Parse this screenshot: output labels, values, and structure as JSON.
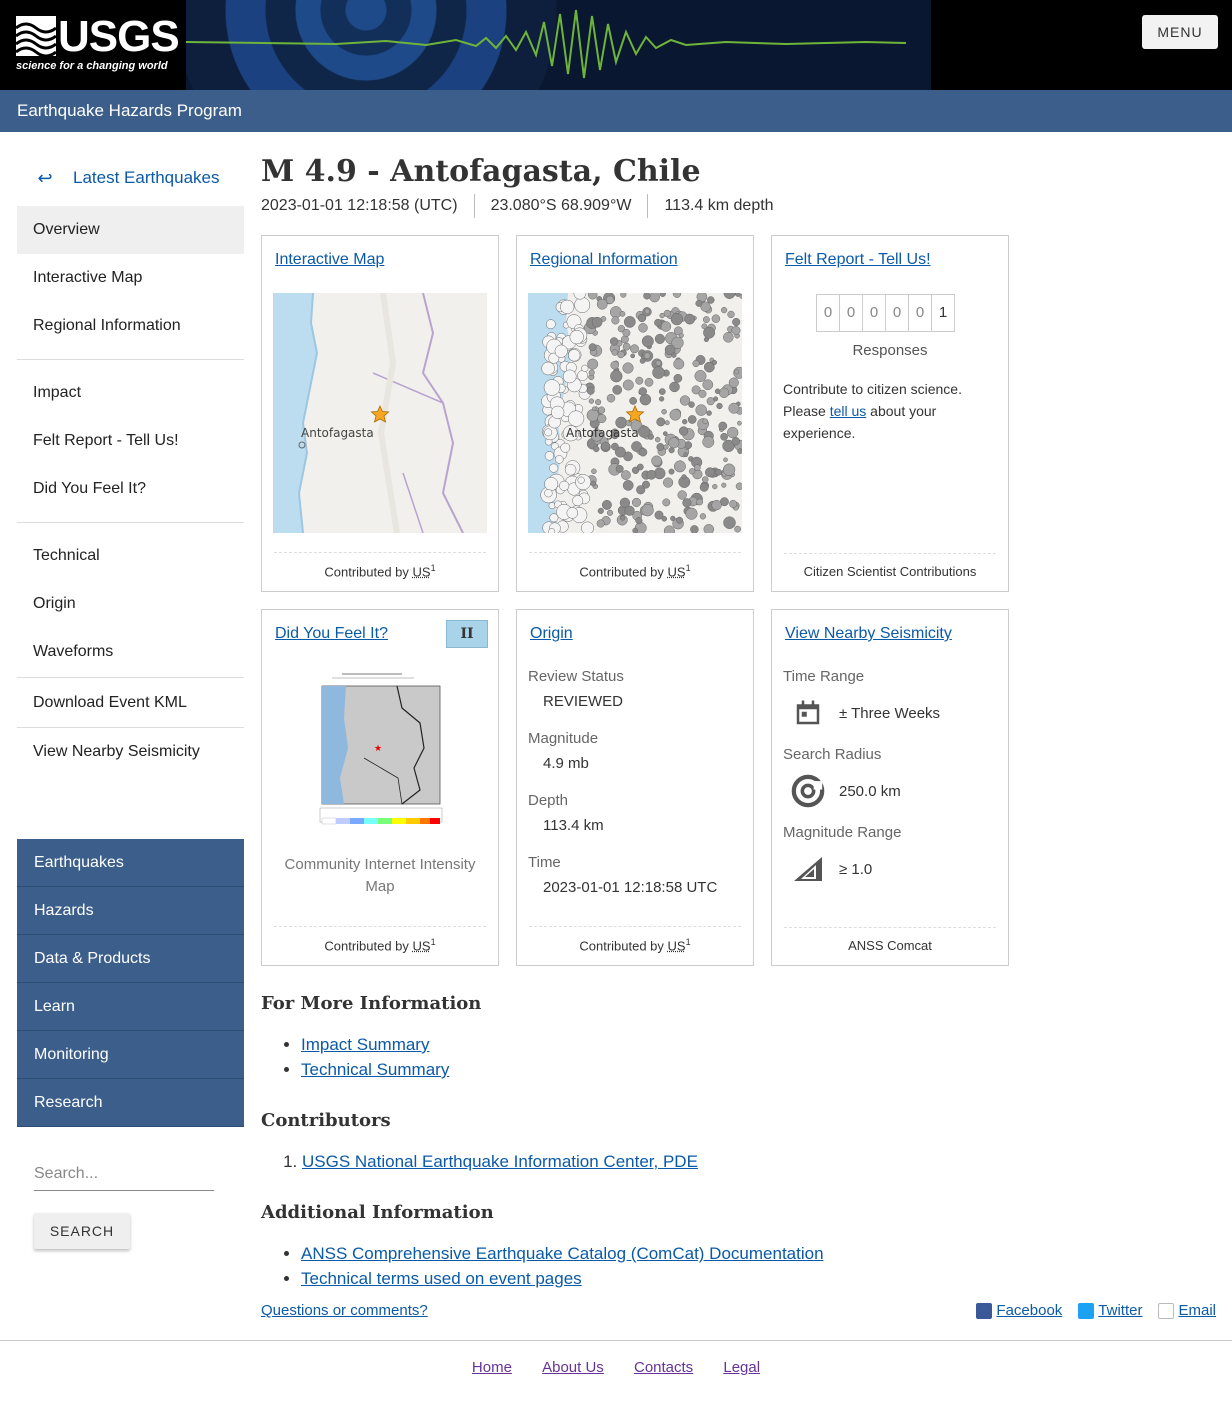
{
  "header": {
    "logo_text": "USGS",
    "logo_tagline": "science for a changing world",
    "menu_label": "MENU",
    "program_name": "Earthquake Hazards Program"
  },
  "sidebar": {
    "back_label": "Latest Earthquakes",
    "back_arrow": "↩",
    "groups": [
      [
        "Overview",
        "Interactive Map",
        "Regional Information"
      ],
      [
        "Impact",
        "Felt Report - Tell Us!",
        "Did You Feel It?"
      ],
      [
        "Technical",
        "Origin",
        "Waveforms"
      ],
      [
        "Download Event KML"
      ],
      [
        "View Nearby Seismicity"
      ]
    ],
    "active_item": "Overview",
    "site_nav": [
      "Earthquakes",
      "Hazards",
      "Data & Products",
      "Learn",
      "Monitoring",
      "Research"
    ],
    "search_placeholder": "Search...",
    "search_button": "SEARCH"
  },
  "event": {
    "title": "M 4.9 - Antofagasta, Chile",
    "time": "2023-01-01 12:18:58 (UTC)",
    "location": "23.080°S 68.909°W",
    "depth": "113.4 km depth"
  },
  "cards": {
    "contributed_prefix": "Contributed by",
    "contributor_abbr": "US",
    "contributor_sup": "1",
    "interactive_map": {
      "title": "Interactive Map",
      "place_label": "Antofagasta"
    },
    "regional": {
      "title": "Regional Information",
      "place_label": "Antofagasta"
    },
    "felt": {
      "title": "Felt Report - Tell Us!",
      "digits": [
        "0",
        "0",
        "0",
        "0",
        "0",
        "1"
      ],
      "responses_label": "Responses",
      "text_before": "Contribute to citizen science. Please ",
      "link_text": "tell us",
      "text_after": " about your experience.",
      "footer": "Citizen Scientist Contributions"
    },
    "dyfi": {
      "title": "Did You Feel It?",
      "mmi": "II",
      "caption": "Community Internet Intensity Map"
    },
    "origin": {
      "title": "Origin",
      "review_status_label": "Review Status",
      "review_status": "REVIEWED",
      "magnitude_label": "Magnitude",
      "magnitude": "4.9 mb",
      "depth_label": "Depth",
      "depth": "113.4 km",
      "time_label": "Time",
      "time": "2023-01-01 12:18:58 UTC"
    },
    "nearby": {
      "title": "View Nearby Seismicity",
      "time_range_label": "Time Range",
      "time_range": "± Three Weeks",
      "radius_label": "Search Radius",
      "radius": "250.0 km",
      "mag_range_label": "Magnitude Range",
      "mag_range": "≥ 1.0",
      "footer": "ANSS Comcat"
    }
  },
  "more_info": {
    "heading": "For More Information",
    "links": [
      "Impact Summary",
      "Technical Summary"
    ]
  },
  "contributors": {
    "heading": "Contributors",
    "items": [
      "USGS National Earthquake Information Center, PDE"
    ]
  },
  "additional": {
    "heading": "Additional Information",
    "links": [
      "ANSS Comprehensive Earthquake Catalog (ComCat) Documentation",
      "Technical terms used on event pages"
    ]
  },
  "footer_links": {
    "questions": "Questions or comments?",
    "facebook": "Facebook",
    "twitter": "Twitter",
    "email": "Email"
  },
  "page_footer": [
    "Home",
    "About Us",
    "Contacts",
    "Legal"
  ],
  "colors": {
    "accent": "#3c5e8a",
    "link": "#0b5aa8",
    "mmi_badge": "#a9d3e8"
  }
}
